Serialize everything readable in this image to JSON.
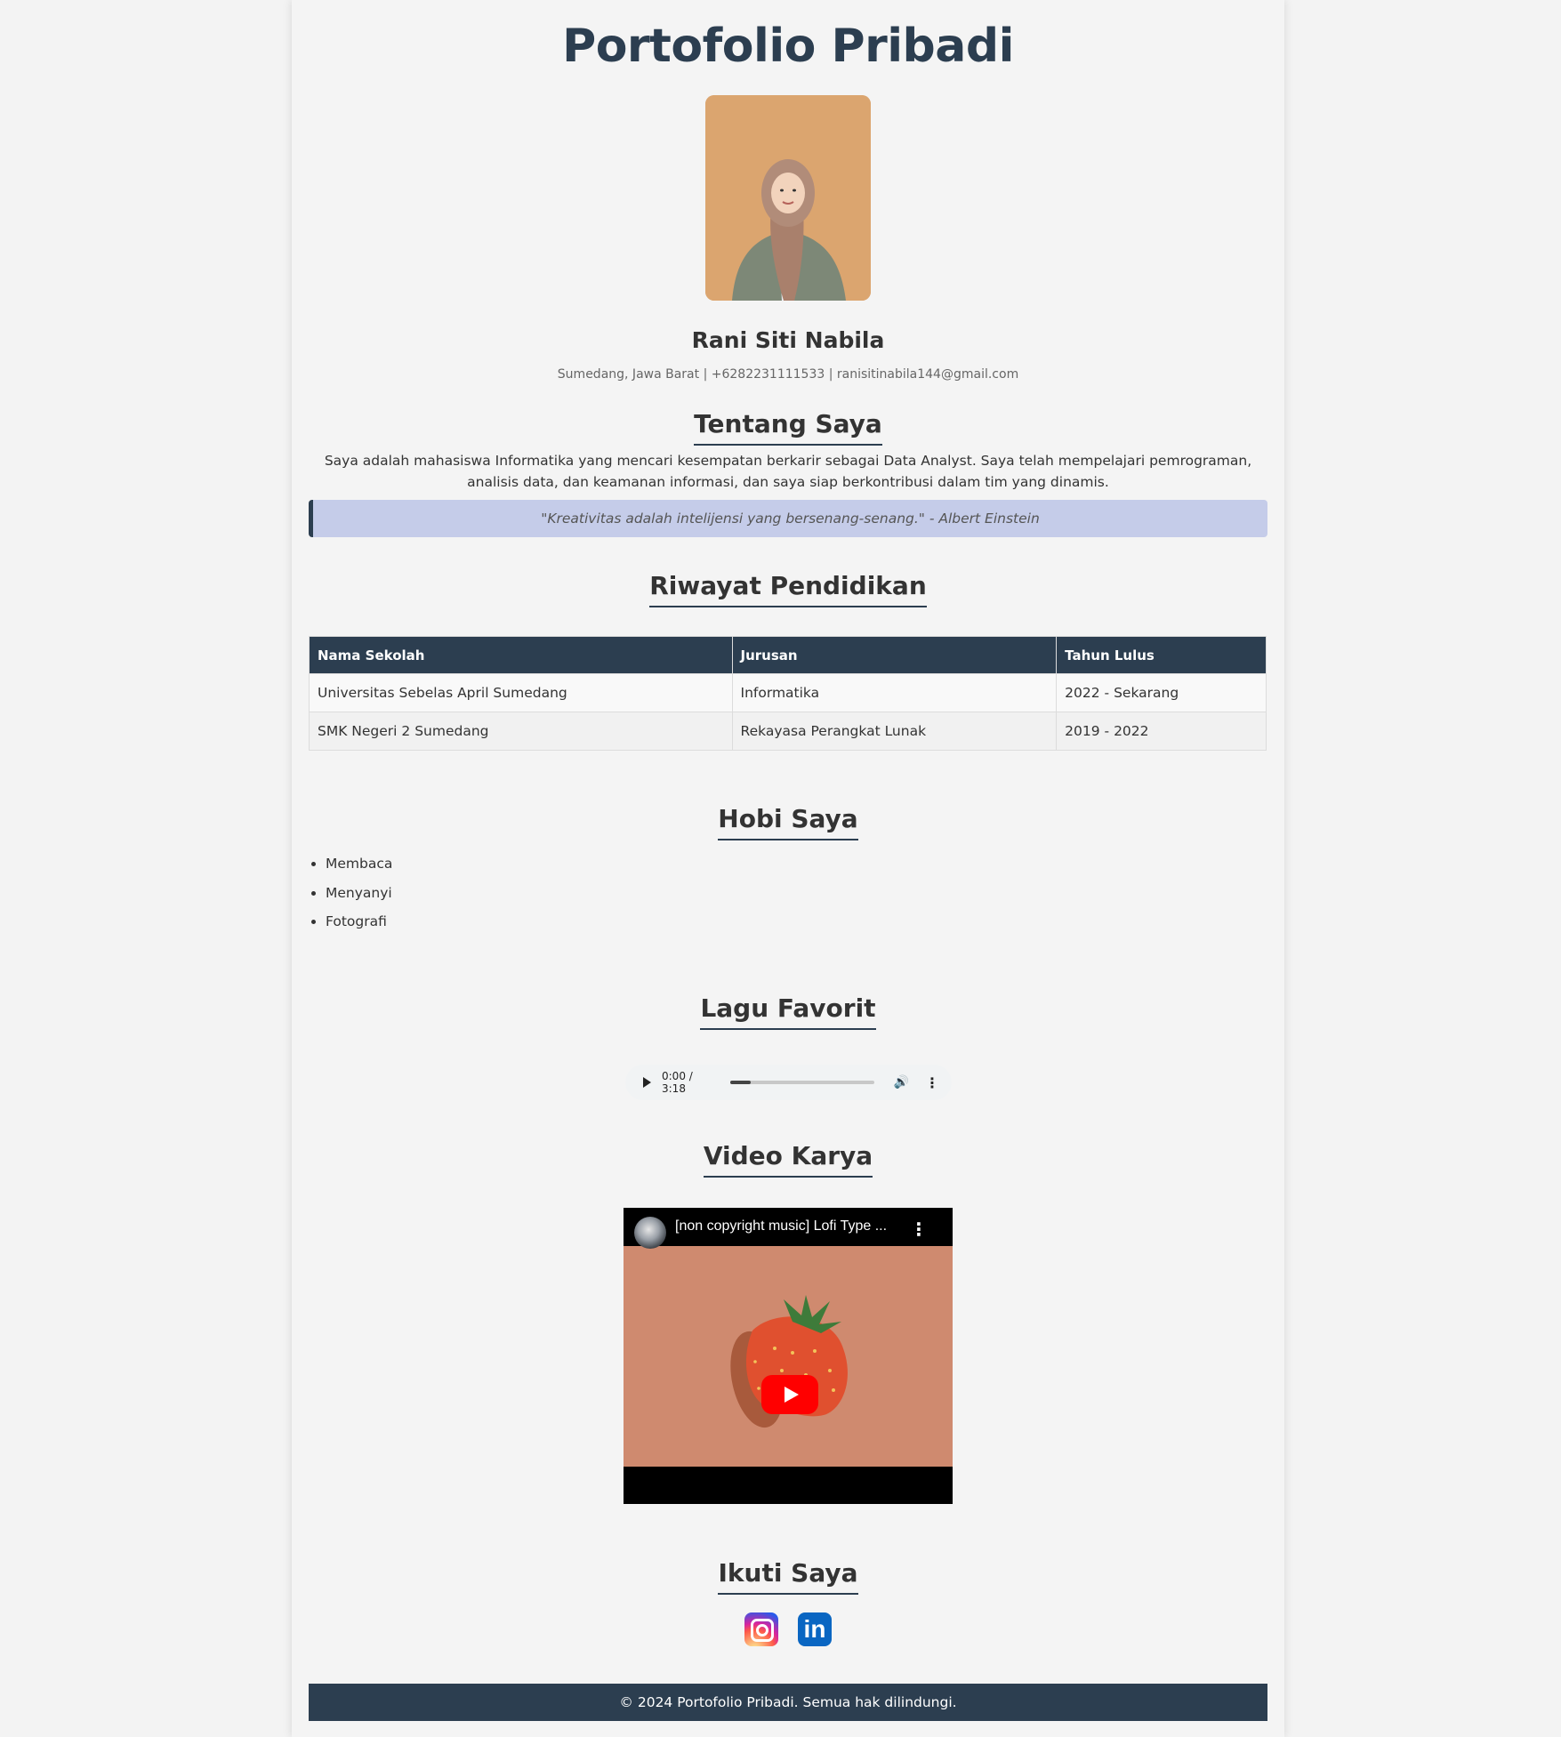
{
  "header": {
    "title": "Portofolio Pribadi"
  },
  "profile": {
    "photo_icon": "profile-photo",
    "name": "Rani Siti Nabila",
    "contact": "Sumedang, Jawa Barat | +6282231111533 | ranisitinabila144@gmail.com"
  },
  "about": {
    "title": "Tentang Saya",
    "text": "Saya adalah mahasiswa Informatika yang mencari kesempatan berkarir sebagai Data Analyst. Saya telah mempelajari pemrograman, analisis data, dan keamanan informasi, dan saya siap berkontribusi dalam tim yang dinamis.",
    "quote": "\"Kreativitas adalah intelijensi yang bersenang-senang.\" - Albert Einstein"
  },
  "education": {
    "title": "Riwayat Pendidikan",
    "columns": [
      "Nama Sekolah",
      "Jurusan",
      "Tahun Lulus"
    ],
    "rows": [
      [
        "Universitas Sebelas April Sumedang",
        "Informatika",
        "2022 - Sekarang"
      ],
      [
        "SMK Negeri 2 Sumedang",
        "Rekayasa Perangkat Lunak",
        "2019 - 2022"
      ]
    ]
  },
  "hobbies": {
    "title": "Hobi Saya",
    "items": [
      "Membaca",
      "Menyanyi",
      "Fotografi"
    ]
  },
  "music": {
    "title": "Lagu Favorit",
    "time": "0:00 / 3:18",
    "progress_fraction": 0.14,
    "play_icon": "play-icon",
    "volume_icon": "volume-icon",
    "more_icon": "more-vertical-icon",
    "volume_glyph": "🔊",
    "more_glyph": "⋮"
  },
  "video": {
    "title": "Video Karya",
    "video_title": "[non copyright music] Lofi Type ...",
    "more_glyph": "⋮"
  },
  "social": {
    "title": "Ikuti Saya",
    "links": [
      {
        "name": "instagram",
        "icon": "instagram-icon"
      },
      {
        "name": "linkedin",
        "icon": "linkedin-icon",
        "glyph": "in"
      }
    ]
  },
  "footer": {
    "text": "© 2024 Portofolio Pribadi. Semua hak dilindungi."
  },
  "colors": {
    "primary": "#2c3e50",
    "quote_bg": "#c5cce9",
    "page_bg": "#f4f4f4"
  }
}
